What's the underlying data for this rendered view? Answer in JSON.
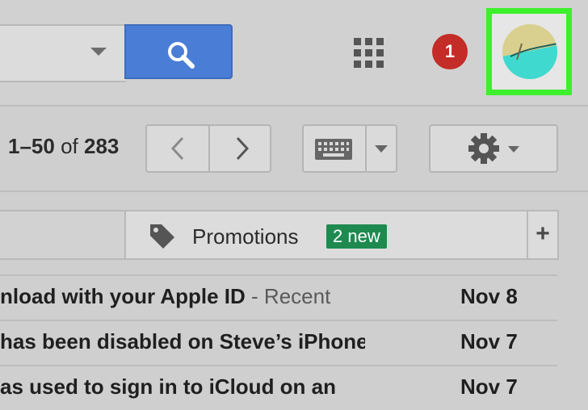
{
  "toolbar": {
    "notification_count": "1",
    "colors": {
      "search_button": "#4a7ed6",
      "badge_red": "#c32c27",
      "highlight": "#3cf02c"
    }
  },
  "pagination": {
    "range": "1–50",
    "of_label": "of",
    "total": "283"
  },
  "tabs": {
    "promotions_label": "Promotions",
    "promotions_badge": "2 new",
    "add_label": "+"
  },
  "emails": [
    {
      "subject": "nload with your Apple ID",
      "snippet": " - Recent",
      "date": "Nov 8"
    },
    {
      "subject": "has been disabled on Steve’s iPhone",
      "snippet": "",
      "date": "Nov 7"
    },
    {
      "subject": "as used to sign in to iCloud on an",
      "snippet": "",
      "date": "Nov 7"
    }
  ]
}
